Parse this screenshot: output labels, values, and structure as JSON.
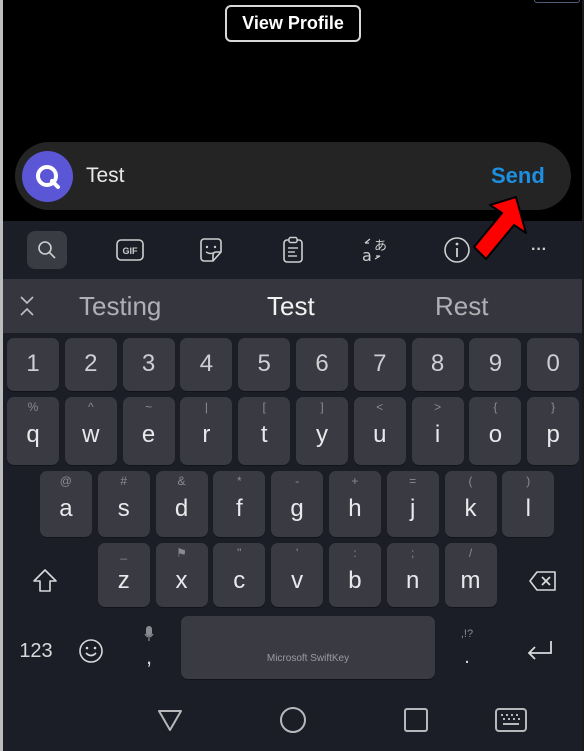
{
  "header": {
    "view_profile_label": "View Profile"
  },
  "composer": {
    "avatar_icon": "search-q-icon",
    "message_text": "Test",
    "send_label": "Send",
    "colors": {
      "avatar": "#5a56d6",
      "send": "#1e8fe0"
    }
  },
  "keyboard": {
    "toolbar": {
      "items": [
        {
          "name": "search",
          "icon": "search-icon",
          "active": true
        },
        {
          "name": "gif",
          "icon": "gif-icon",
          "label": "GIF"
        },
        {
          "name": "stickers",
          "icon": "sticker-icon"
        },
        {
          "name": "clipboard",
          "icon": "clipboard-icon"
        },
        {
          "name": "translate",
          "icon": "translate-icon",
          "label": "あ"
        },
        {
          "name": "info",
          "icon": "info-icon"
        },
        {
          "name": "more",
          "icon": "more-icon",
          "label": "···"
        }
      ]
    },
    "suggestions": [
      "Testing",
      "Test",
      "Rest"
    ],
    "rows": {
      "numbers": [
        "1",
        "2",
        "3",
        "4",
        "5",
        "6",
        "7",
        "8",
        "9",
        "0"
      ],
      "row1": [
        {
          "key": "q",
          "alt": "%"
        },
        {
          "key": "w",
          "alt": "^"
        },
        {
          "key": "e",
          "alt": "~"
        },
        {
          "key": "r",
          "alt": "|"
        },
        {
          "key": "t",
          "alt": "["
        },
        {
          "key": "y",
          "alt": "]"
        },
        {
          "key": "u",
          "alt": "<"
        },
        {
          "key": "i",
          "alt": ">"
        },
        {
          "key": "o",
          "alt": "{"
        },
        {
          "key": "p",
          "alt": "}"
        }
      ],
      "row2": [
        {
          "key": "a",
          "alt": "@"
        },
        {
          "key": "s",
          "alt": "#"
        },
        {
          "key": "d",
          "alt": "&"
        },
        {
          "key": "f",
          "alt": "*"
        },
        {
          "key": "g",
          "alt": "-"
        },
        {
          "key": "h",
          "alt": "+"
        },
        {
          "key": "j",
          "alt": "="
        },
        {
          "key": "k",
          "alt": "("
        },
        {
          "key": "l",
          "alt": ")"
        }
      ],
      "row3": [
        {
          "key": "z",
          "alt": "_"
        },
        {
          "key": "x",
          "alt": "⚑"
        },
        {
          "key": "c",
          "alt": "\""
        },
        {
          "key": "v",
          "alt": "'"
        },
        {
          "key": "b",
          "alt": ":"
        },
        {
          "key": "n",
          "alt": ";"
        },
        {
          "key": "m",
          "alt": "/"
        }
      ]
    },
    "bottom": {
      "numbers_label": "123",
      "comma_label": ",",
      "space_label": "Microsoft SwiftKey",
      "period_label": ".",
      "period_alt": ",!?"
    }
  },
  "navbar": {
    "items": [
      "back-icon",
      "home-icon",
      "recents-icon",
      "keyboard-switch-icon"
    ]
  },
  "annotation": {
    "arrow_color": "#ff0000",
    "points_to": "Send"
  }
}
